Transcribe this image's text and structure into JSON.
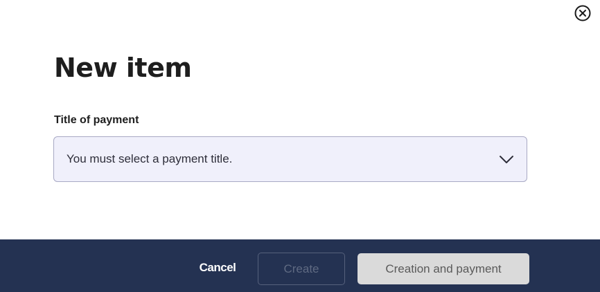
{
  "dialog": {
    "title": "New item",
    "close_icon": "close-circle-icon"
  },
  "form": {
    "payment_title": {
      "label": "Title of payment",
      "value": "You must select a payment title.",
      "icon": "chevron-down-icon"
    }
  },
  "footer": {
    "cancel_label": "Cancel",
    "create_label": "Create",
    "create_and_pay_label": "Creation and payment"
  },
  "colors": {
    "footer_bg": "#243252",
    "select_bg": "#f0f0fb",
    "select_border": "#a8a9c4",
    "disabled_button_bg": "#dadada"
  }
}
